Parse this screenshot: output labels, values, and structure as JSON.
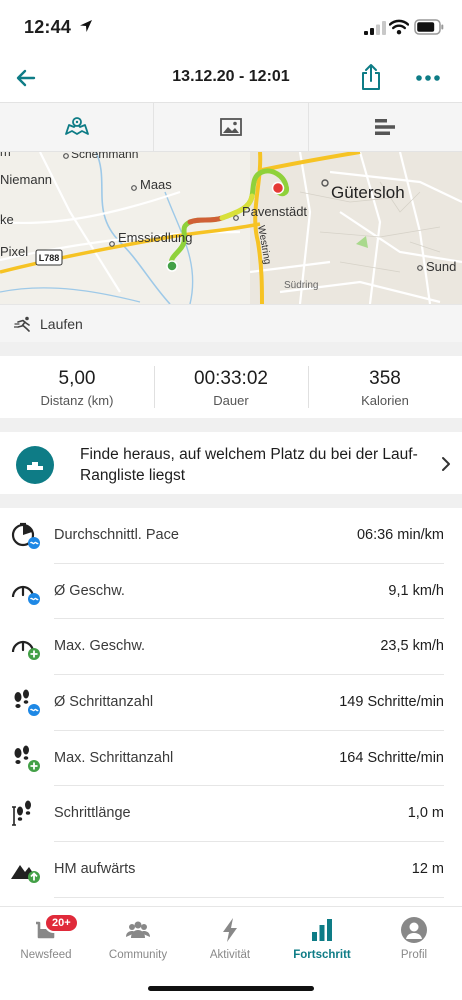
{
  "status_bar": {
    "time": "12:44"
  },
  "header": {
    "title": "13.12.20 - 12:01"
  },
  "tabs": [
    {
      "name": "map",
      "icon": "map-icon",
      "active": true
    },
    {
      "name": "photos",
      "icon": "image-icon",
      "active": false
    },
    {
      "name": "splits",
      "icon": "bars-icon",
      "active": false
    }
  ],
  "map": {
    "labels": {
      "schemmann": "Schemmann",
      "niemann": "Niemann",
      "maas": "Maas",
      "guetersloh": "Gütersloh",
      "pavenstaedt": "Pavenstädt",
      "ke": "ke",
      "emssiedlung": "Emssiedlung",
      "westring": "Westring",
      "pixel": "Pixel",
      "l788": "L788",
      "sudring": "Südring",
      "sund": "Sund"
    }
  },
  "activity": {
    "label": "Laufen"
  },
  "summary": [
    {
      "value": "5,00",
      "label": "Distanz (km)"
    },
    {
      "value": "00:33:02",
      "label": "Dauer"
    },
    {
      "value": "358",
      "label": "Kalorien"
    }
  ],
  "promo": {
    "text": "Finde heraus, auf welchem Platz du bei der Lauf-Rangliste liegst"
  },
  "stats": [
    {
      "label": "Durchschnittl. Pace",
      "value": "06:36 min/km",
      "icon": "pace-icon"
    },
    {
      "label": "Ø Geschw.",
      "value": "9,1 km/h",
      "icon": "speed-avg-icon"
    },
    {
      "label": "Max. Geschw.",
      "value": "23,5 km/h",
      "icon": "speed-max-icon"
    },
    {
      "label": "Ø Schrittanzahl",
      "value": "149 Schritte/min",
      "icon": "cadence-avg-icon"
    },
    {
      "label": "Max. Schrittanzahl",
      "value": "164 Schritte/min",
      "icon": "cadence-max-icon"
    },
    {
      "label": "Schrittlänge",
      "value": "1,0 m",
      "icon": "stride-icon"
    },
    {
      "label": "HM aufwärts",
      "value": "12 m",
      "icon": "elevation-up-icon"
    }
  ],
  "tabbar": [
    {
      "label": "Newsfeed",
      "badge": "20+",
      "icon": "newsfeed-icon"
    },
    {
      "label": "Community",
      "icon": "community-icon"
    },
    {
      "label": "Aktivität",
      "icon": "activity-bolt-icon"
    },
    {
      "label": "Fortschritt",
      "icon": "progress-icon",
      "active": true
    },
    {
      "label": "Profil",
      "icon": "profile-icon"
    }
  ],
  "colors": {
    "accent": "#0e7c86",
    "badge": "#e02a3a",
    "route_green": "#7ed321",
    "route_red": "#e53935"
  }
}
